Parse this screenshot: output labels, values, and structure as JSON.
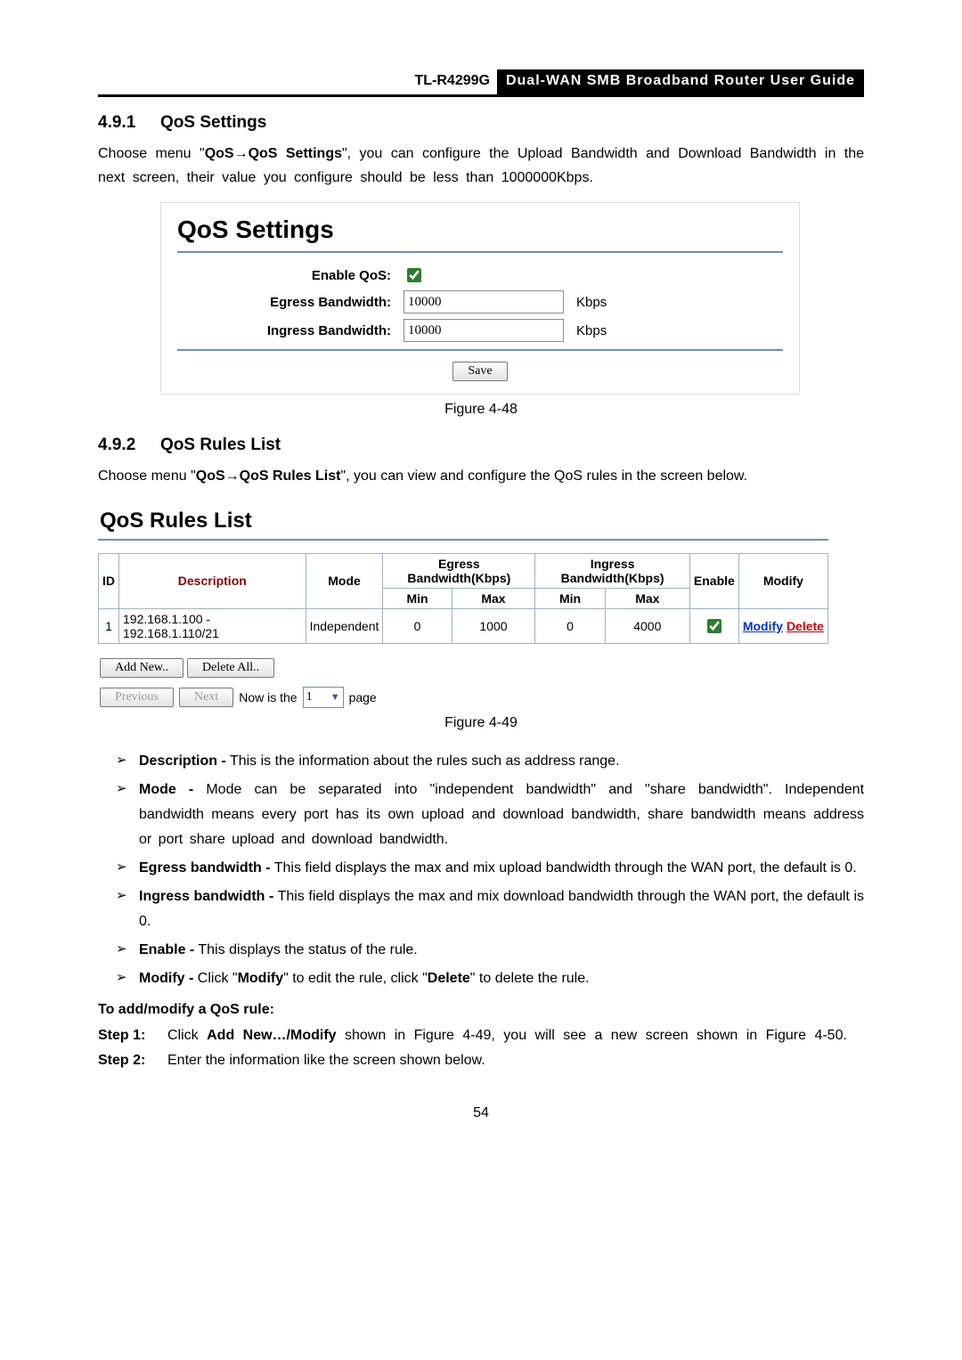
{
  "header": {
    "model": "TL-R4299G",
    "title": "Dual-WAN SMB Broadband Router User Guide"
  },
  "s1": {
    "num": "4.9.1",
    "title": "QoS Settings",
    "para_a": "Choose menu \"",
    "para_bold": "QoS→QoS Settings",
    "para_b": "\", you can configure the Upload Bandwidth and Download Bandwidth in the next screen, their value you configure should be less than 1000000Kbps."
  },
  "shot1": {
    "title": "QoS Settings",
    "enable_label": "Enable QoS:",
    "enable_checked": true,
    "egress_label": "Egress Bandwidth:",
    "egress_value": "10000",
    "ingress_label": "Ingress Bandwidth:",
    "ingress_value": "10000",
    "unit": "Kbps",
    "save": "Save"
  },
  "fig1": "Figure 4-48",
  "s2": {
    "num": "4.9.2",
    "title": "QoS Rules List",
    "para_a": "Choose menu \"",
    "para_bold": "QoS→QoS Rules List",
    "para_b": "\", you can view and configure the QoS rules in the screen below."
  },
  "shot2": {
    "title": "QoS Rules List",
    "cols": {
      "id": "ID",
      "desc": "Description",
      "mode": "Mode",
      "egress": "Egress Bandwidth(Kbps)",
      "ingress": "Ingress Bandwidth(Kbps)",
      "min": "Min",
      "max": "Max",
      "enable": "Enable",
      "modify": "Modify"
    },
    "row": {
      "id": "1",
      "desc": "192.168.1.100 - 192.168.1.110/21",
      "mode": "Independent",
      "emin": "0",
      "emax": "1000",
      "imin": "0",
      "imax": "4000",
      "modify": "Modify",
      "delete": "Delete"
    },
    "add": "Add New..",
    "delall": "Delete All..",
    "prev": "Previous",
    "next": "Next",
    "nowis": "Now is the",
    "page": "page",
    "pagenum": "1"
  },
  "fig2": "Figure 4-49",
  "bullets": {
    "desc_t": "Description -",
    "desc_b": " This is the information about the rules such as address range.",
    "mode_t": "Mode -",
    "mode_b": " Mode can be separated into \"independent bandwidth\" and \"share bandwidth\". Independent bandwidth means every port has its own upload and download bandwidth, share bandwidth means address or port share upload and download bandwidth.",
    "eg_t": "Egress bandwidth -",
    "eg_b": " This field displays the max and mix upload bandwidth through the WAN port, the default is 0.",
    "in_t": "Ingress bandwidth -",
    "in_b": " This field displays the max and mix download bandwidth through the WAN port, the default is 0.",
    "en_t": "Enable -",
    "en_b": " This displays the status of the rule.",
    "mo_t": "Modify -",
    "mo_b1": " Click \"",
    "mo_b2": "Modify",
    "mo_b3": "\" to edit the rule, click \"",
    "mo_b4": "Delete",
    "mo_b5": "\" to delete the rule."
  },
  "addmod_h": "To add/modify a QoS rule:",
  "step1": {
    "label": "Step 1:",
    "a": "Click ",
    "bold": "Add New…/Modify",
    "b": " shown in Figure 4-49, you will see a new screen shown in Figure 4-50."
  },
  "step2": {
    "label": "Step 2:",
    "body": "Enter the information like the screen shown below."
  },
  "page_no": "54"
}
